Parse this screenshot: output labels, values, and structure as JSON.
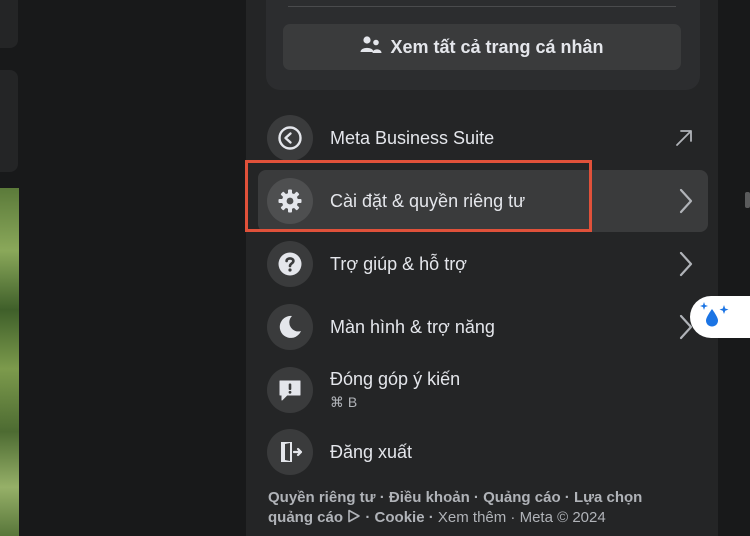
{
  "profile": {
    "see_all_label": "Xem tất cả trang cá nhân"
  },
  "menu": {
    "items": [
      {
        "label": "Meta Business Suite",
        "icon": "meta-business-icon",
        "right_icon": "external-arrow-icon"
      },
      {
        "label": "Cài đặt & quyền riêng tư",
        "icon": "gear-icon",
        "right_icon": "chevron-right-icon"
      },
      {
        "label": "Trợ giúp & hỗ trợ",
        "icon": "question-icon",
        "right_icon": "chevron-right-icon"
      },
      {
        "label": "Màn hình & trợ năng",
        "icon": "moon-icon",
        "right_icon": "chevron-right-icon"
      },
      {
        "label": "Đóng góp ý kiến",
        "sublabel": "⌘ B",
        "icon": "feedback-icon"
      },
      {
        "label": "Đăng xuất",
        "icon": "logout-icon"
      }
    ]
  },
  "footer": {
    "privacy": "Quyền riêng tư",
    "terms": "Điều khoản",
    "ads": "Quảng cáo",
    "ad_choices": "Lựa chọn quảng cáo",
    "cookie": "Cookie",
    "more": "Xem thêm",
    "copyright": "Meta © 2024",
    "sep": " · "
  },
  "colors": {
    "highlight_border": "#e0513a",
    "panel_bg": "#242526",
    "ai_bubble_accent": "#1b74e4"
  }
}
